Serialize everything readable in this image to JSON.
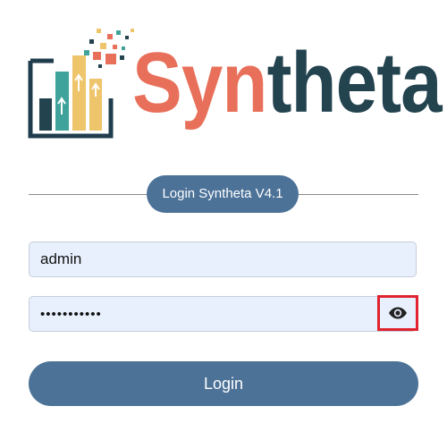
{
  "brand": {
    "name_part1": "Syn",
    "name_part2": "theta",
    "colors": {
      "coral": "#e8705a",
      "navy": "#23434f",
      "teal": "#3fa39b",
      "yellow": "#eec56b",
      "frame": "#1f3d4c"
    }
  },
  "login": {
    "version_label": "Login Syntheta V4.1",
    "username_value": "admin",
    "password_value": "•••••••••••",
    "show_password_icon": "eye-icon",
    "submit_label": "Login"
  },
  "colors": {
    "primary": "#4c7298",
    "input_bg": "#e8f0fd",
    "highlight": "#e0232e"
  }
}
